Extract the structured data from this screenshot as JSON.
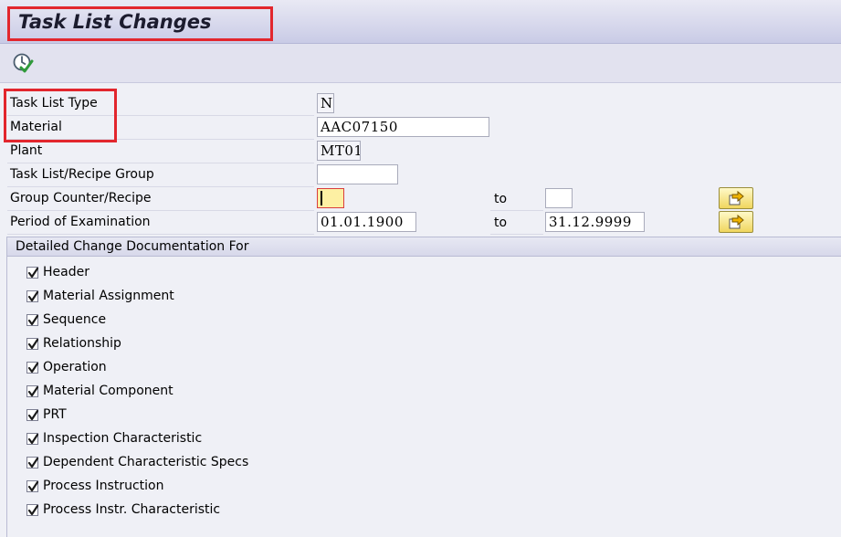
{
  "title": "Task List Changes",
  "fields": {
    "task_list_type": {
      "label": "Task List Type",
      "value": "N"
    },
    "material": {
      "label": "Material",
      "value": "AAC07150"
    },
    "plant": {
      "label": "Plant",
      "value": "MT01"
    },
    "group": {
      "label": "Task List/Recipe Group",
      "value": ""
    },
    "counter": {
      "label": "Group Counter/Recipe",
      "value": "",
      "to_label": "to",
      "to_value": ""
    },
    "period": {
      "label": "Period of Examination",
      "value": "01.01.1900",
      "to_label": "to",
      "to_value": "31.12.9999"
    }
  },
  "section": {
    "title": "Detailed Change Documentation For",
    "items": [
      {
        "label": "Header",
        "checked": true
      },
      {
        "label": "Material Assignment",
        "checked": true
      },
      {
        "label": "Sequence",
        "checked": true
      },
      {
        "label": "Relationship",
        "checked": true
      },
      {
        "label": "Operation",
        "checked": true
      },
      {
        "label": "Material Component",
        "checked": true
      },
      {
        "label": "PRT",
        "checked": true
      },
      {
        "label": "Inspection Characteristic",
        "checked": true
      },
      {
        "label": "Dependent Characteristic Specs",
        "checked": true
      },
      {
        "label": "Process Instruction",
        "checked": true
      },
      {
        "label": "Process Instr. Characteristic",
        "checked": true
      }
    ]
  },
  "icons": {
    "execute": "execute-icon",
    "multiple_selection": "multiple-selection-icon",
    "checkbox": "checkmark-icon"
  },
  "colors": {
    "highlight": "#e2262d",
    "focus_field": "#fdf0a3"
  }
}
